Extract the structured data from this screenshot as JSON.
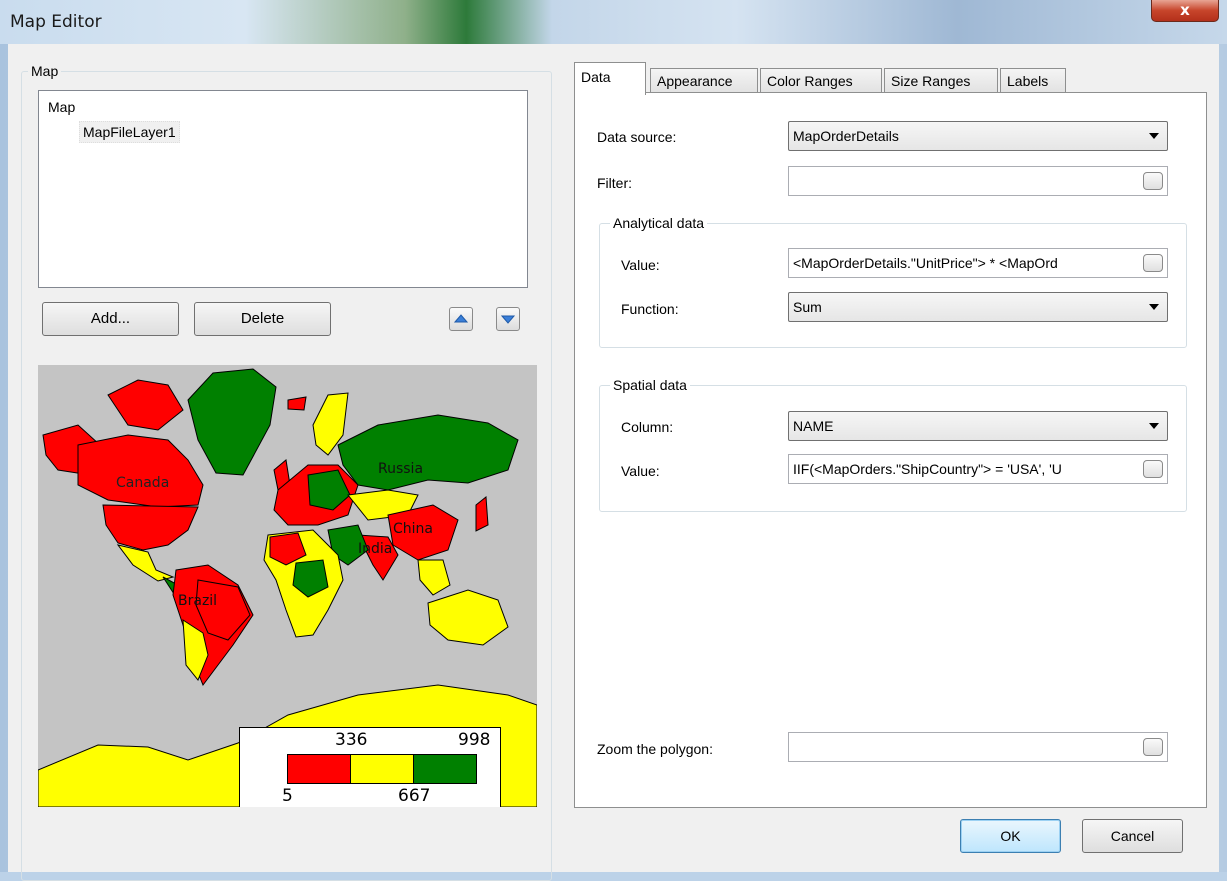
{
  "window": {
    "title": "Map Editor",
    "close_glyph": "x"
  },
  "map_group": {
    "caption": "Map",
    "tree": {
      "root": "Map",
      "children": [
        "MapFileLayer1"
      ]
    },
    "add_label": "Add...",
    "delete_label": "Delete",
    "up_icon": "arrow-up-icon",
    "down_icon": "arrow-down-icon"
  },
  "preview": {
    "labels": {
      "canada": "Canada",
      "russia": "Russia",
      "china": "China",
      "india": "India",
      "brazil": "Brazil"
    },
    "legend": {
      "top_values": [
        "336",
        "998"
      ],
      "bottom_values": [
        "5",
        "667"
      ],
      "colors": [
        "#ff0000",
        "#ffff00",
        "#008000"
      ]
    },
    "country_colors": {
      "red": "#ff0000",
      "yellow": "#ffff00",
      "green": "#008000",
      "background": "#c4c4c4"
    }
  },
  "tabs": [
    "Data",
    "Appearance",
    "Color Ranges",
    "Size Ranges",
    "Labels"
  ],
  "active_tab": "Data",
  "data_tab": {
    "data_source_label": "Data source:",
    "data_source_value": "MapOrderDetails",
    "filter_label": "Filter:",
    "filter_value": "",
    "analytical": {
      "caption": "Analytical data",
      "value_label": "Value:",
      "value": "<MapOrderDetails.\"UnitPrice\"> * <MapOrd",
      "function_label": "Function:",
      "function_value": "Sum"
    },
    "spatial": {
      "caption": "Spatial data",
      "column_label": "Column:",
      "column_value": "NAME",
      "value_label": "Value:",
      "value": "IIF(<MapOrders.\"ShipCountry\"> = 'USA', 'U"
    },
    "zoom_label": "Zoom the polygon:",
    "zoom_value": ""
  },
  "footer": {
    "ok_label": "OK",
    "cancel_label": "Cancel"
  }
}
